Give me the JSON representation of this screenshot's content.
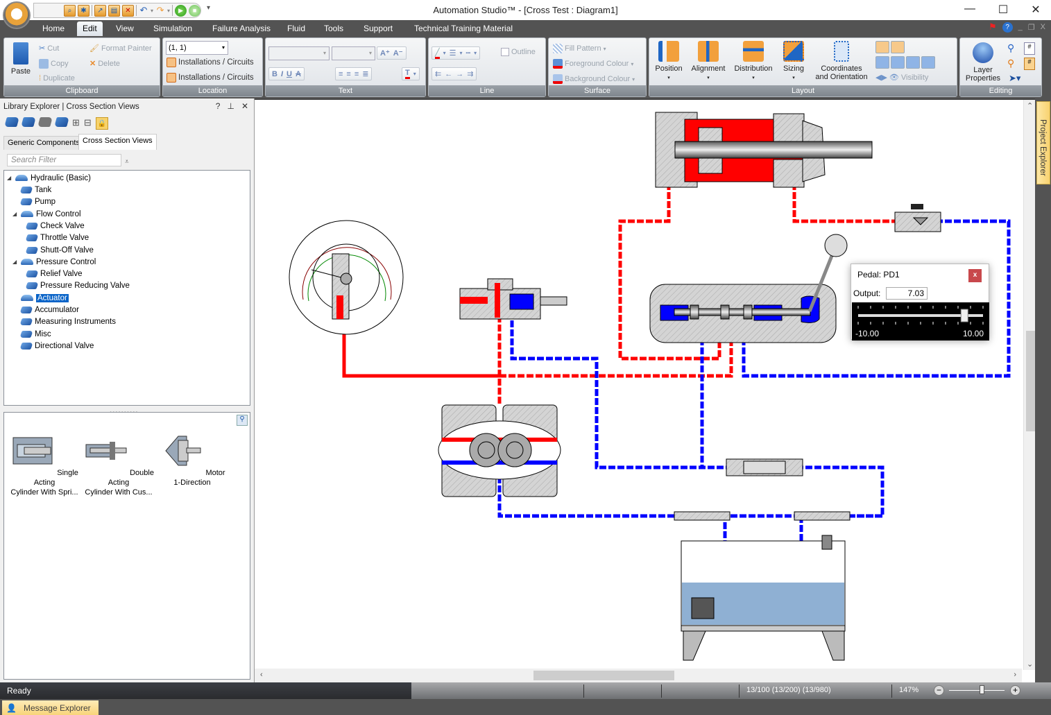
{
  "window": {
    "title": "Automation Studio™  - [Cross Test : Diagram1]",
    "controls": {
      "minimize": "—",
      "maximize": "☐",
      "close": "✕"
    }
  },
  "quick_access": {
    "icons": [
      "open-icon",
      "settings-icon",
      "export-icon",
      "save-icon",
      "close-doc-icon",
      "undo-icon",
      "redo-icon",
      "run-icon",
      "stop-icon"
    ],
    "customize": "▾"
  },
  "menu": {
    "items": [
      "Home",
      "Edit",
      "View",
      "Simulation",
      "Failure Analysis",
      "Fluid",
      "Tools",
      "Support",
      "Technical Training Material"
    ],
    "active": "Edit"
  },
  "ribbon": {
    "clipboard": {
      "label": "Clipboard",
      "paste": "Paste",
      "cut": "Cut",
      "copy": "Copy",
      "duplicate": "Duplicate",
      "format_painter": "Format Painter",
      "delete": "Delete"
    },
    "location": {
      "label": "Location",
      "coords": "(1, 1)",
      "item1": "Installations / Circuits",
      "item2": "Installations / Circuits"
    },
    "text": {
      "label": "Text",
      "font": "",
      "size": "",
      "grow": "A⁺",
      "shrink": "A⁻",
      "bold": "B",
      "italic": "I",
      "underline": "U",
      "strike": "A",
      "color": "T"
    },
    "line": {
      "label": "Line",
      "outline": "Outline"
    },
    "surface": {
      "label": "Surface",
      "fill_pattern": "Fill Pattern",
      "foreground": "Foreground Colour",
      "background": "Background Colour"
    },
    "layout": {
      "label": "Layout",
      "position": "Position",
      "alignment": "Alignment",
      "distribution": "Distribution",
      "sizing": "Sizing",
      "coords_line1": "Coordinates",
      "coords_line2": "and Orientation",
      "visibility": "Visibility"
    },
    "editing": {
      "label": "Editing",
      "layer_line1": "Layer",
      "layer_line2": "Properties"
    }
  },
  "library": {
    "title": "Library Explorer | Cross Section Views",
    "controls": [
      "?",
      "⊥",
      "✕"
    ],
    "tabs": [
      "Generic Components",
      "Cross Section Views"
    ],
    "active_tab": "Cross Section Views",
    "search_placeholder": "Search Filter",
    "tree": [
      {
        "label": "Hydraulic (Basic)",
        "level": 0,
        "expanded": true
      },
      {
        "label": "Tank",
        "level": 1
      },
      {
        "label": "Pump",
        "level": 1
      },
      {
        "label": "Flow Control",
        "level": 1,
        "expanded": true
      },
      {
        "label": "Check Valve",
        "level": 2
      },
      {
        "label": "Throttle Valve",
        "level": 2
      },
      {
        "label": "Shutt-Off Valve",
        "level": 2
      },
      {
        "label": "Pressure Control",
        "level": 1,
        "expanded": true
      },
      {
        "label": "Relief Valve",
        "level": 2
      },
      {
        "label": "Pressure Reducing Valve",
        "level": 2
      },
      {
        "label": "Actuator",
        "level": 1,
        "selected": true
      },
      {
        "label": "Accumulator",
        "level": 1
      },
      {
        "label": "Measuring Instruments",
        "level": 1
      },
      {
        "label": "Misc",
        "level": 1
      },
      {
        "label": "Directional Valve",
        "level": 1
      }
    ],
    "preview": [
      {
        "line1": "Single Acting",
        "line2": "Cylinder With Spri..."
      },
      {
        "line1": "Double Acting",
        "line2": "Cylinder With Cus..."
      },
      {
        "line1": "Motor 1-Direction",
        "line2": ""
      }
    ]
  },
  "diagram": {
    "colors": {
      "pressure": "#ff0000",
      "return": "#0000ff",
      "body": "#d4d4d4",
      "oil": "#8fb0d3"
    },
    "components": [
      "double-acting-cylinder",
      "pressure-gauge",
      "pressure-relief-valve",
      "directional-control-valve",
      "shut-off-valve",
      "gear-pump",
      "flow-meter",
      "reservoir-tank"
    ]
  },
  "pedal": {
    "title": "Pedal: PD1",
    "close": "x",
    "output_label": "Output:",
    "output_value": "7.03",
    "min": "-10.00",
    "max": "10.00",
    "value": 7.03
  },
  "side_tabs": {
    "project_explorer": "Project Explorer",
    "message_explorer": "Message Explorer"
  },
  "status": {
    "ready": "Ready",
    "counts": "13/100 (13/200) (13/980)",
    "zoom": "147%",
    "zoom_fraction": 0.6
  }
}
